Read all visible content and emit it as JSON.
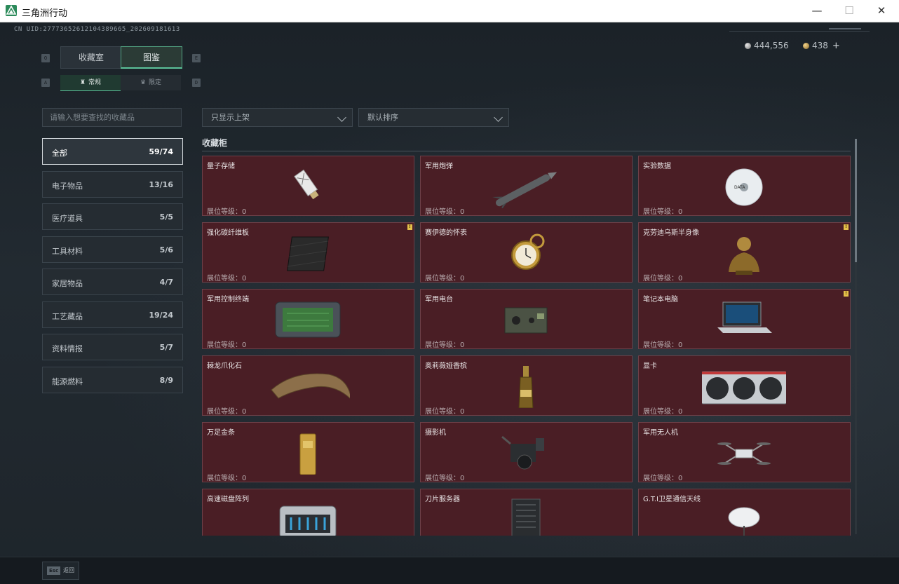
{
  "window": {
    "title": "三角洲行动",
    "min": "—",
    "max": "☐",
    "close": "✕"
  },
  "uid": "CN UID:27773652612104389665_202609181613",
  "currency": {
    "silver": "444,556",
    "gold": "438",
    "plus": "+"
  },
  "keys": {
    "q": "Q",
    "e": "E",
    "a": "A",
    "d": "D",
    "esc": "Esc"
  },
  "tabs": {
    "collection": "收藏室",
    "catalog": "图鉴"
  },
  "subtabs": {
    "regular": "常规",
    "limited": "限定"
  },
  "search_placeholder": "请输入想要查找的收藏品",
  "filters": {
    "shelf": "只显示上架",
    "sort": "默认排序"
  },
  "categories": [
    {
      "label": "全部",
      "count": "59/74"
    },
    {
      "label": "电子物品",
      "count": "13/16"
    },
    {
      "label": "医疗道具",
      "count": "5/5"
    },
    {
      "label": "工具材料",
      "count": "5/6"
    },
    {
      "label": "家居物品",
      "count": "4/7"
    },
    {
      "label": "工艺藏品",
      "count": "19/24"
    },
    {
      "label": "资料情报",
      "count": "5/7"
    },
    {
      "label": "能源燃料",
      "count": "8/9"
    }
  ],
  "section_title": "收藏柜",
  "level_label": "展位等级：",
  "items": [
    {
      "name": "量子存储",
      "level": "0",
      "badge": false,
      "icon": "usb-drive-icon"
    },
    {
      "name": "军用炮弹",
      "level": "0",
      "badge": false,
      "icon": "missile-icon"
    },
    {
      "name": "实验数据",
      "level": "0",
      "badge": false,
      "icon": "disc-icon"
    },
    {
      "name": "强化碳纤维板",
      "level": "0",
      "badge": true,
      "icon": "carbon-plate-icon"
    },
    {
      "name": "赛伊德的怀表",
      "level": "0",
      "badge": false,
      "icon": "pocket-watch-icon"
    },
    {
      "name": "克劳迪乌斯半身像",
      "level": "0",
      "badge": true,
      "icon": "bust-icon"
    },
    {
      "name": "军用控制终端",
      "level": "0",
      "badge": false,
      "icon": "tablet-terminal-icon"
    },
    {
      "name": "军用电台",
      "level": "0",
      "badge": false,
      "icon": "radio-icon"
    },
    {
      "name": "笔记本电脑",
      "level": "0",
      "badge": true,
      "icon": "laptop-icon"
    },
    {
      "name": "棘龙爪化石",
      "level": "0",
      "badge": false,
      "icon": "claw-fossil-icon"
    },
    {
      "name": "奥莉薇娅香槟",
      "level": "0",
      "badge": false,
      "icon": "champagne-icon"
    },
    {
      "name": "显卡",
      "level": "0",
      "badge": false,
      "icon": "gpu-icon"
    },
    {
      "name": "万足金条",
      "level": "0",
      "badge": false,
      "icon": "gold-bar-icon"
    },
    {
      "name": "摄影机",
      "level": "0",
      "badge": false,
      "icon": "camera-icon"
    },
    {
      "name": "军用无人机",
      "level": "0",
      "badge": false,
      "icon": "drone-icon"
    },
    {
      "name": "高速磁盘阵列",
      "level": "0",
      "badge": false,
      "icon": "disk-array-icon"
    },
    {
      "name": "刀片服务器",
      "level": "0",
      "badge": false,
      "icon": "server-icon"
    },
    {
      "name": "G.T.I卫星通信天线",
      "level": "0",
      "badge": false,
      "icon": "satellite-dish-icon"
    }
  ],
  "badge_text": "!",
  "esc_label": "返回"
}
